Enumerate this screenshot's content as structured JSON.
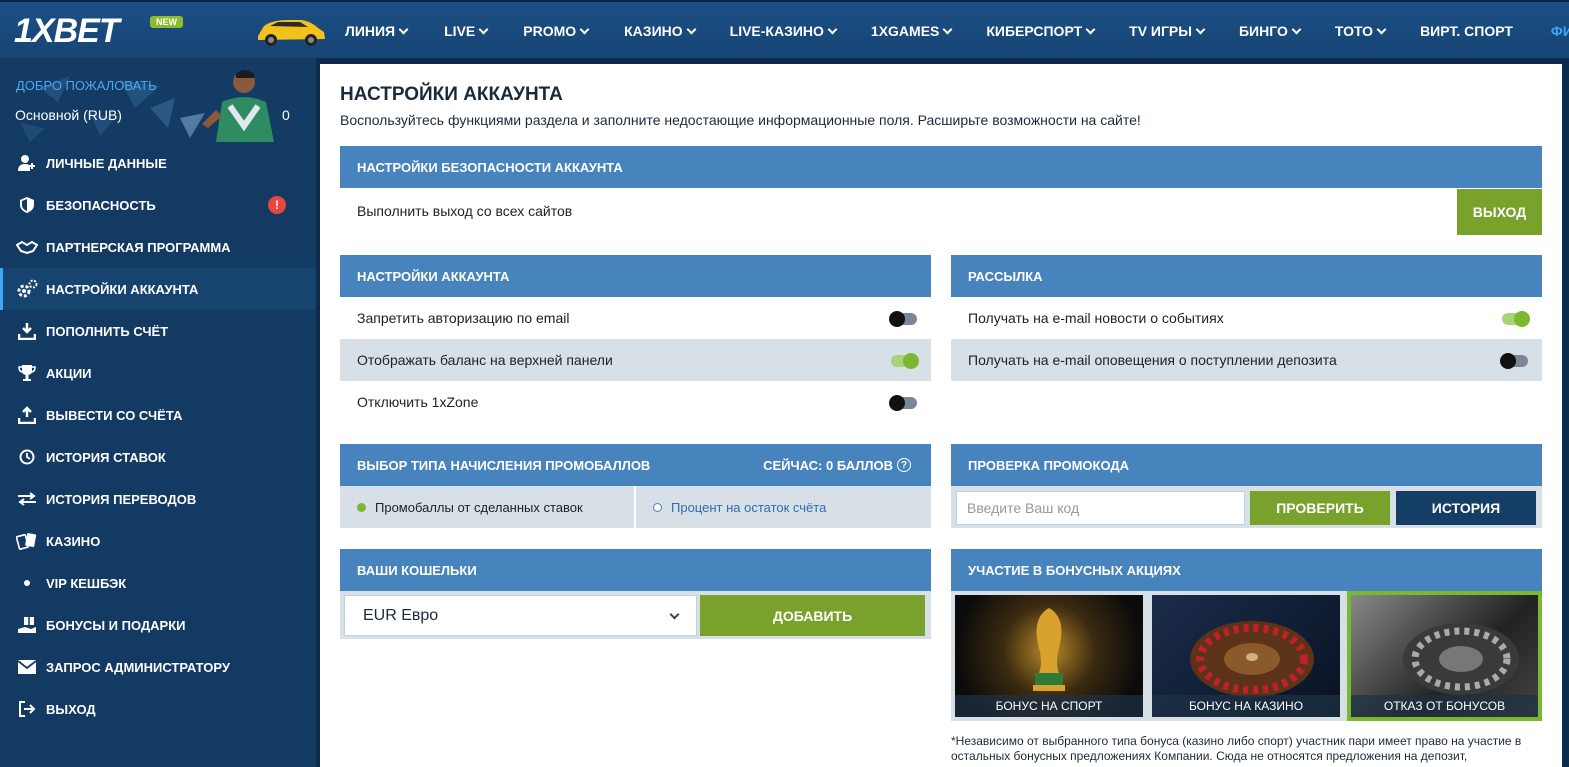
{
  "brand": {
    "logo": "1XBET",
    "new_badge": "NEW"
  },
  "nav": {
    "items": [
      {
        "label": "ЛИНИЯ",
        "chevron": true
      },
      {
        "label": "LIVE",
        "chevron": true
      },
      {
        "label": "PROMO",
        "chevron": true
      },
      {
        "label": "КАЗИНО",
        "chevron": true
      },
      {
        "label": "LIVE-КАЗИНО",
        "chevron": true
      },
      {
        "label": "1XGAMES",
        "chevron": true
      },
      {
        "label": "КИБЕРСПОРТ",
        "chevron": true
      },
      {
        "label": "TV ИГРЫ",
        "chevron": true
      },
      {
        "label": "БИНГО",
        "chevron": true
      },
      {
        "label": "ТОТО",
        "chevron": true
      },
      {
        "label": "ВИРТ. СПОРТ",
        "chevron": false
      },
      {
        "label": "ФИНСТА",
        "chevron": false
      }
    ]
  },
  "sidebar": {
    "welcome": "ДОБРО ПОЖАЛОВАТЬ",
    "account": "Основной (RUB)",
    "balance": "0",
    "items": [
      {
        "label": "ЛИЧНЫЕ ДАННЫЕ",
        "icon": "user-add-icon"
      },
      {
        "label": "БЕЗОПАСНОСТЬ",
        "icon": "shield-icon",
        "alert": "!"
      },
      {
        "label": "ПАРТНЕРСКАЯ ПРОГРАММА",
        "icon": "handshake-icon"
      },
      {
        "label": "НАСТРОЙКИ АККАУНТА",
        "icon": "gears-icon",
        "active": true
      },
      {
        "label": "ПОПОЛНИТЬ СЧЁТ",
        "icon": "download-icon"
      },
      {
        "label": "АКЦИИ",
        "icon": "trophy-icon"
      },
      {
        "label": "ВЫВЕСТИ СО СЧЁТА",
        "icon": "upload-icon"
      },
      {
        "label": "ИСТОРИЯ СТАВОК",
        "icon": "clock-icon"
      },
      {
        "label": "ИСТОРИЯ ПЕРЕВОДОВ",
        "icon": "transfer-icon"
      },
      {
        "label": "КАЗИНО",
        "icon": "cards-icon"
      },
      {
        "label": "VIP КЕШБЭК",
        "icon": "dot-icon"
      },
      {
        "label": "БОНУСЫ И ПОДАРКИ",
        "icon": "gift-hand-icon"
      },
      {
        "label": "ЗАПРОС АДМИНИСТРАТОРУ",
        "icon": "mail-icon"
      },
      {
        "label": "ВЫХОД",
        "icon": "logout-icon"
      }
    ]
  },
  "main": {
    "title": "НАСТРОЙКИ АККАУНТА",
    "subtitle": "Воспользуйтесь функциями раздела и заполните недостающие информационные поля. Расширьте возможности на сайте!",
    "security": {
      "header": "НАСТРОЙКИ БЕЗОПАСНОСТИ АККАУНТА",
      "row_label": "Выполнить выход со всех сайтов",
      "button": "ВЫХОД"
    },
    "account_settings": {
      "header": "НАСТРОЙКИ АККАУНТА",
      "options": [
        {
          "label": "Запретить авторизацию по email",
          "on": false
        },
        {
          "label": "Отображать баланс на верхней панели",
          "on": true
        },
        {
          "label": "Отключить 1xZone",
          "on": false
        }
      ]
    },
    "mailing": {
      "header": "РАССЫЛКА",
      "options": [
        {
          "label": "Получать на e-mail новости о событиях",
          "on": true
        },
        {
          "label": "Получать на e-mail оповещения о поступлении депозита",
          "on": false
        }
      ]
    },
    "promo_points": {
      "header": "ВЫБОР ТИПА НАЧИСЛЕНИЯ ПРОМОБАЛЛОВ",
      "current": "СЕЙЧАС: 0 БАЛЛОВ",
      "help": "?",
      "option1": "Промобаллы от сделанных ставок",
      "option2": "Процент на остаток счёта"
    },
    "promo_check": {
      "header": "ПРОВЕРКА ПРОМОКОДА",
      "placeholder": "Введите Ваш код",
      "check_button": "ПРОВЕРИТЬ",
      "history_button": "ИСТОРИЯ"
    },
    "wallets": {
      "header": "ВАШИ КОШЕЛЬКИ",
      "selected": "EUR Евро",
      "add_button": "ДОБАВИТЬ"
    },
    "bonus": {
      "header": "УЧАСТИЕ В БОНУСНЫХ АКЦИЯХ",
      "cards": [
        {
          "label": "БОНУС НА СПОРТ"
        },
        {
          "label": "БОНУС НА КАЗИНО"
        },
        {
          "label": "ОТКАЗ ОТ БОНУСОВ"
        }
      ],
      "note": "*Независимо от выбранного типа бонуса (казино либо спорт) участник пари имеет право на участие в остальных бонусных предложениях Компании. Сюда не относятся предложения на депозит,"
    }
  },
  "colors": {
    "accent": "#3fa9f5",
    "bar": "#4783bc",
    "green": "#78a22c",
    "dark": "#153e66",
    "alert": "#e8453c"
  }
}
